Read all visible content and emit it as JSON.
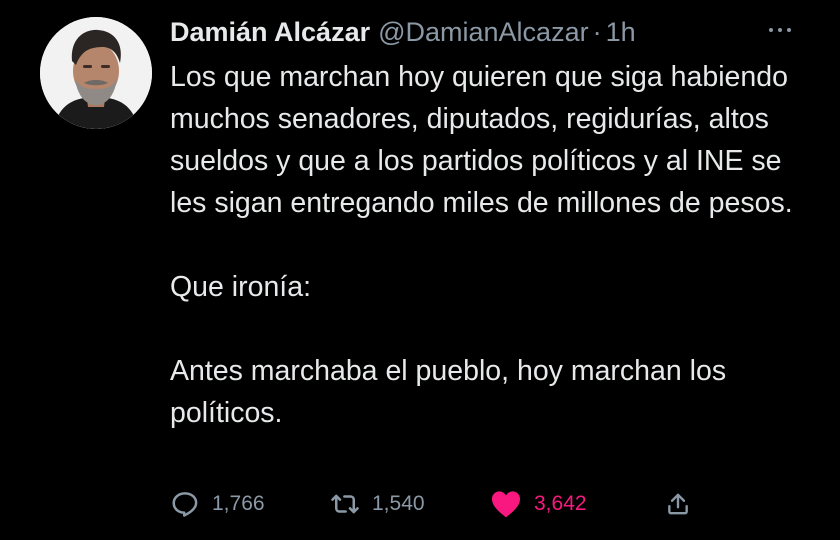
{
  "author": {
    "display_name": "Damián Alcázar",
    "handle": "@DamianAlcazar",
    "separator": "·",
    "time": "1h"
  },
  "tweet": {
    "paragraphs": [
      "Los que marchan hoy quieren que siga habiendo muchos senadores, diputados, regidurías, altos sueldos y que a los partidos políticos y al INE se les sigan entregando miles de millones de pesos.",
      "Que ironía:",
      "Antes marchaba el pueblo, hoy marchan los políticos."
    ]
  },
  "actions": {
    "reply_count": "1,766",
    "retweet_count": "1,540",
    "like_count": "3,642"
  },
  "icons": {
    "reply": "reply-icon",
    "retweet": "retweet-icon",
    "like": "heart-icon",
    "share": "share-icon",
    "more": "more-icon"
  },
  "colors": {
    "background": "#000000",
    "text": "#e7e9ea",
    "secondary": "#8b98a5",
    "like": "#f91880"
  }
}
